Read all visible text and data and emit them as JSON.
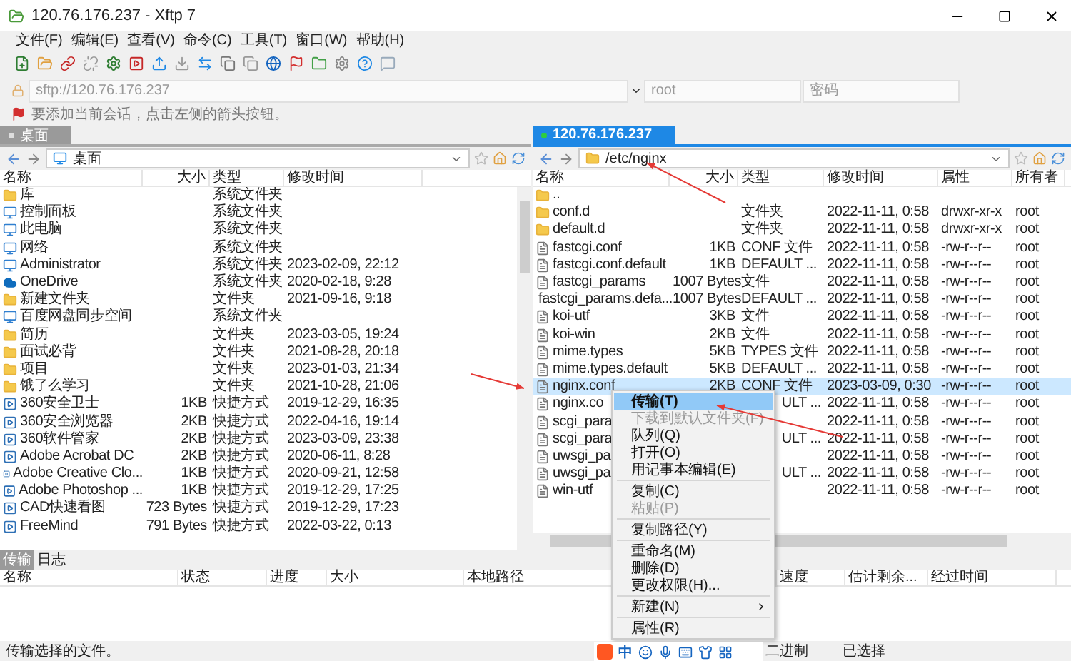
{
  "window": {
    "title": "120.76.176.237 - Xftp 7"
  },
  "menu": [
    "文件(F)",
    "编辑(E)",
    "查看(V)",
    "命令(C)",
    "工具(T)",
    "窗口(W)",
    "帮助(H)"
  ],
  "address": {
    "placeholder": "sftp://120.76.176.237",
    "user_placeholder": "root",
    "password_placeholder": "密码"
  },
  "hint": "要添加当前会话，点击左侧的箭头按钮。",
  "panes": [
    {
      "tab": {
        "label": "桌面",
        "selected": false
      },
      "path": "桌面",
      "columns": [
        "名称",
        "大小",
        "类型",
        "修改时间"
      ],
      "rows": [
        {
          "kind": "folder",
          "name": "库",
          "size": "",
          "type": "系统文件夹",
          "modified": ""
        },
        {
          "kind": "system",
          "name": "控制面板",
          "size": "",
          "type": "系统文件夹",
          "modified": ""
        },
        {
          "kind": "system",
          "name": "此电脑",
          "size": "",
          "type": "系统文件夹",
          "modified": ""
        },
        {
          "kind": "system",
          "name": "网络",
          "size": "",
          "type": "系统文件夹",
          "modified": ""
        },
        {
          "kind": "system",
          "name": "Administrator",
          "size": "",
          "type": "系统文件夹",
          "modified": "2023-02-09, 22:12"
        },
        {
          "kind": "cloud",
          "name": "OneDrive",
          "size": "",
          "type": "系统文件夹",
          "modified": "2020-02-18, 9:28"
        },
        {
          "kind": "folder",
          "name": "新建文件夹",
          "size": "",
          "type": "文件夹",
          "modified": "2021-09-16, 9:18"
        },
        {
          "kind": "system",
          "name": "百度网盘同步空间",
          "size": "",
          "type": "系统文件夹",
          "modified": ""
        },
        {
          "kind": "folder",
          "name": "简历",
          "size": "",
          "type": "文件夹",
          "modified": "2023-03-05, 19:24"
        },
        {
          "kind": "folder",
          "name": "面试必背",
          "size": "",
          "type": "文件夹",
          "modified": "2021-08-28, 20:18"
        },
        {
          "kind": "folder",
          "name": "项目",
          "size": "",
          "type": "文件夹",
          "modified": "2023-01-03, 21:34"
        },
        {
          "kind": "folder",
          "name": "饿了么学习",
          "size": "",
          "type": "文件夹",
          "modified": "2021-10-28, 21:06"
        },
        {
          "kind": "shortcut",
          "name": "360安全卫士",
          "size": "1KB",
          "type": "快捷方式",
          "modified": "2019-12-29, 16:35"
        },
        {
          "kind": "shortcut",
          "name": "360安全浏览器",
          "size": "2KB",
          "type": "快捷方式",
          "modified": "2022-04-16, 19:14"
        },
        {
          "kind": "shortcut",
          "name": "360软件管家",
          "size": "2KB",
          "type": "快捷方式",
          "modified": "2023-03-09, 23:38"
        },
        {
          "kind": "shortcut",
          "name": "Adobe Acrobat DC",
          "size": "2KB",
          "type": "快捷方式",
          "modified": "2020-06-11, 8:28"
        },
        {
          "kind": "shortcut",
          "name": "Adobe Creative Clo...",
          "size": "1KB",
          "type": "快捷方式",
          "modified": "2020-09-21, 12:58"
        },
        {
          "kind": "shortcut",
          "name": "Adobe Photoshop ...",
          "size": "1KB",
          "type": "快捷方式",
          "modified": "2019-12-29, 17:25"
        },
        {
          "kind": "shortcut",
          "name": "CAD快速看图",
          "size": "723 Bytes",
          "type": "快捷方式",
          "modified": "2019-12-29, 17:23"
        },
        {
          "kind": "shortcut",
          "name": "FreeMind",
          "size": "791 Bytes",
          "type": "快捷方式",
          "modified": "2022-03-22, 0:13"
        }
      ]
    },
    {
      "tab": {
        "label": "120.76.176.237",
        "selected": true
      },
      "path": "/etc/nginx",
      "columns": [
        "名称",
        "大小",
        "类型",
        "修改时间",
        "属性",
        "所有者"
      ],
      "rows": [
        {
          "kind": "folder",
          "name": "..",
          "size": "",
          "type": "",
          "modified": "",
          "attributes": "",
          "owner": "",
          "selected": false
        },
        {
          "kind": "folder",
          "name": "conf.d",
          "size": "",
          "type": "文件夹",
          "modified": "2022-11-11, 0:58",
          "attributes": "drwxr-xr-x",
          "owner": "root",
          "selected": false
        },
        {
          "kind": "folder",
          "name": "default.d",
          "size": "",
          "type": "文件夹",
          "modified": "2022-11-11, 0:58",
          "attributes": "drwxr-xr-x",
          "owner": "root",
          "selected": false
        },
        {
          "kind": "file",
          "name": "fastcgi.conf",
          "size": "1KB",
          "type": "CONF 文件",
          "modified": "2022-11-11, 0:58",
          "attributes": "-rw-r--r--",
          "owner": "root",
          "selected": false
        },
        {
          "kind": "file",
          "name": "fastcgi.conf.default",
          "size": "1KB",
          "type": "DEFAULT ...",
          "modified": "2022-11-11, 0:58",
          "attributes": "-rw-r--r--",
          "owner": "root",
          "selected": false
        },
        {
          "kind": "file",
          "name": "fastcgi_params",
          "size": "1007 Bytes",
          "type": "文件",
          "modified": "2022-11-11, 0:58",
          "attributes": "-rw-r--r--",
          "owner": "root",
          "selected": false
        },
        {
          "kind": "file",
          "name": "fastcgi_params.defa...",
          "size": "1007 Bytes",
          "type": "DEFAULT ...",
          "modified": "2022-11-11, 0:58",
          "attributes": "-rw-r--r--",
          "owner": "root",
          "selected": false
        },
        {
          "kind": "file",
          "name": "koi-utf",
          "size": "3KB",
          "type": "文件",
          "modified": "2022-11-11, 0:58",
          "attributes": "-rw-r--r--",
          "owner": "root",
          "selected": false
        },
        {
          "kind": "file",
          "name": "koi-win",
          "size": "2KB",
          "type": "文件",
          "modified": "2022-11-11, 0:58",
          "attributes": "-rw-r--r--",
          "owner": "root",
          "selected": false
        },
        {
          "kind": "file",
          "name": "mime.types",
          "size": "5KB",
          "type": "TYPES 文件",
          "modified": "2022-11-11, 0:58",
          "attributes": "-rw-r--r--",
          "owner": "root",
          "selected": false
        },
        {
          "kind": "file",
          "name": "mime.types.default",
          "size": "5KB",
          "type": "DEFAULT ...",
          "modified": "2022-11-11, 0:58",
          "attributes": "-rw-r--r--",
          "owner": "root",
          "selected": false
        },
        {
          "kind": "file",
          "name": "nginx.conf",
          "size": "2KB",
          "type": "CONF 文件",
          "modified": "2023-03-09, 0:30",
          "attributes": "-rw-r--r--",
          "owner": "root",
          "selected": true
        },
        {
          "kind": "file",
          "name": "nginx.co",
          "size": "",
          "type": "ULT ...",
          "modified": "2022-11-11, 0:58",
          "attributes": "-rw-r--r--",
          "owner": "root",
          "selected": false
        },
        {
          "kind": "file",
          "name": "scgi_para",
          "size": "",
          "type": "",
          "modified": "2022-11-11, 0:58",
          "attributes": "-rw-r--r--",
          "owner": "root",
          "selected": false
        },
        {
          "kind": "file",
          "name": "scgi_para",
          "size": "",
          "type": "ULT ...",
          "modified": "2022-11-11, 0:58",
          "attributes": "-rw-r--r--",
          "owner": "root",
          "selected": false
        },
        {
          "kind": "file",
          "name": "uwsgi_pa",
          "size": "",
          "type": "",
          "modified": "2022-11-11, 0:58",
          "attributes": "-rw-r--r--",
          "owner": "root",
          "selected": false
        },
        {
          "kind": "file",
          "name": "uwsgi_pa",
          "size": "",
          "type": "ULT ...",
          "modified": "2022-11-11, 0:58",
          "attributes": "-rw-r--r--",
          "owner": "root",
          "selected": false
        },
        {
          "kind": "file",
          "name": "win-utf",
          "size": "",
          "type": "",
          "modified": "2022-11-11, 0:58",
          "attributes": "-rw-r--r--",
          "owner": "root",
          "selected": false
        }
      ]
    }
  ],
  "context_menu": [
    {
      "kind": "item",
      "label": "传输(T)",
      "selected": true,
      "disabled": false
    },
    {
      "kind": "item",
      "label": "下载到默认文件夹(F)",
      "selected": false,
      "disabled": true
    },
    {
      "kind": "item",
      "label": "队列(Q)",
      "selected": false,
      "disabled": false
    },
    {
      "kind": "item",
      "label": "打开(O)",
      "selected": false,
      "disabled": false
    },
    {
      "kind": "item",
      "label": "用记事本编辑(E)",
      "selected": false,
      "disabled": false
    },
    {
      "kind": "separator"
    },
    {
      "kind": "item",
      "label": "复制(C)",
      "selected": false,
      "disabled": false
    },
    {
      "kind": "item",
      "label": "粘贴(P)",
      "selected": false,
      "disabled": true
    },
    {
      "kind": "separator"
    },
    {
      "kind": "item",
      "label": "复制路径(Y)",
      "selected": false,
      "disabled": false
    },
    {
      "kind": "separator"
    },
    {
      "kind": "item",
      "label": "重命名(M)",
      "selected": false,
      "disabled": false
    },
    {
      "kind": "item",
      "label": "删除(D)",
      "selected": false,
      "disabled": false
    },
    {
      "kind": "item",
      "label": "更改权限(H)...",
      "selected": false,
      "disabled": false
    },
    {
      "kind": "separator"
    },
    {
      "kind": "submenu",
      "label": "新建(N)",
      "selected": false,
      "disabled": false
    },
    {
      "kind": "separator"
    },
    {
      "kind": "item",
      "label": "属性(R)",
      "selected": false,
      "disabled": false
    }
  ],
  "transfer": {
    "tabs": [
      {
        "label": "传输",
        "selected": true
      },
      {
        "label": "日志",
        "selected": false
      }
    ],
    "columns": [
      "名称",
      "状态",
      "进度",
      "大小",
      "本地路径",
      "速度",
      "估计剩余...",
      "经过时间"
    ]
  },
  "status_bar": {
    "text": "传输选择的文件。",
    "items": [
      "二进制",
      "已选择"
    ]
  },
  "ime": {
    "label": "中"
  }
}
